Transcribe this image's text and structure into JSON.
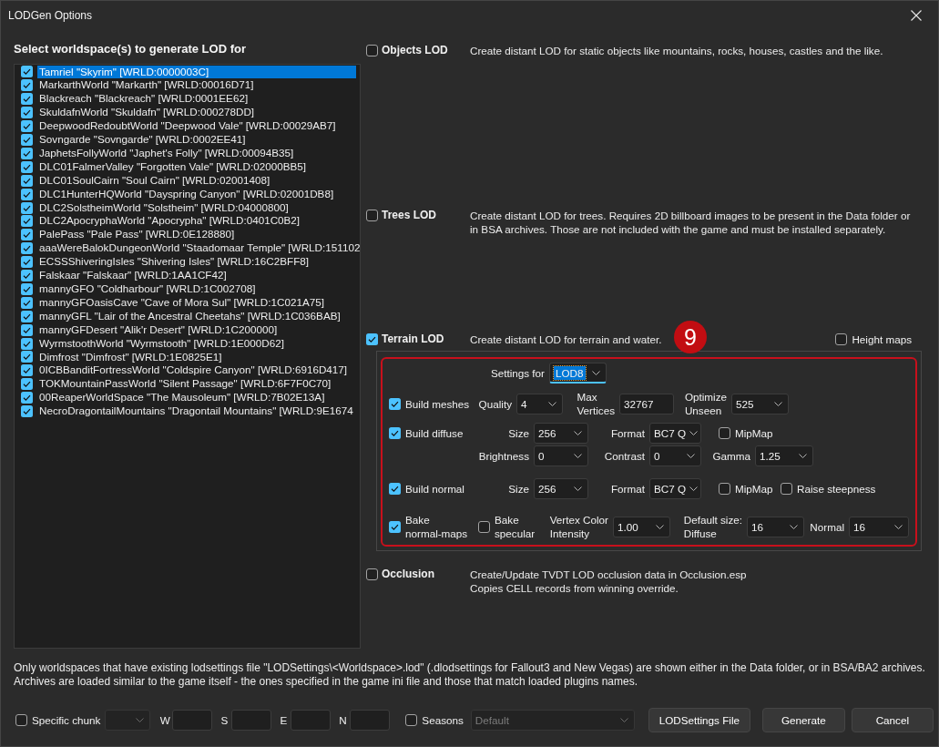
{
  "window": {
    "title": "LODGen Options"
  },
  "worldspaces": {
    "heading": "Select worldspace(s) to generate LOD for",
    "items": [
      {
        "label": "Tamriel \"Skyrim\" [WRLD:0000003C]",
        "checked": true,
        "selected": true
      },
      {
        "label": "MarkarthWorld \"Markarth\" [WRLD:00016D71]",
        "checked": true,
        "selected": false
      },
      {
        "label": "Blackreach \"Blackreach\" [WRLD:0001EE62]",
        "checked": true,
        "selected": false
      },
      {
        "label": "SkuldafnWorld \"Skuldafn\" [WRLD:000278DD]",
        "checked": true,
        "selected": false
      },
      {
        "label": "DeepwoodRedoubtWorld \"Deepwood Vale\" [WRLD:00029AB7]",
        "checked": true,
        "selected": false
      },
      {
        "label": "Sovngarde \"Sovngarde\" [WRLD:0002EE41]",
        "checked": true,
        "selected": false
      },
      {
        "label": "JaphetsFollyWorld \"Japhet's Folly\" [WRLD:00094B35]",
        "checked": true,
        "selected": false
      },
      {
        "label": "DLC01FalmerValley \"Forgotten Vale\" [WRLD:02000BB5]",
        "checked": true,
        "selected": false
      },
      {
        "label": "DLC01SoulCairn \"Soul Cairn\" [WRLD:02001408]",
        "checked": true,
        "selected": false
      },
      {
        "label": "DLC1HunterHQWorld \"Dayspring Canyon\" [WRLD:02001DB8]",
        "checked": true,
        "selected": false
      },
      {
        "label": "DLC2SolstheimWorld \"Solstheim\" [WRLD:04000800]",
        "checked": true,
        "selected": false
      },
      {
        "label": "DLC2ApocryphaWorld \"Apocrypha\" [WRLD:0401C0B2]",
        "checked": true,
        "selected": false
      },
      {
        "label": "PalePass \"Pale Pass\" [WRLD:0E128880]",
        "checked": true,
        "selected": false
      },
      {
        "label": "aaaWereBalokDungeonWorld \"Staadomaar Temple\" [WRLD:151102",
        "checked": true,
        "selected": false
      },
      {
        "label": "ECSSShiveringIsles \"Shivering Isles\" [WRLD:16C2BFF8]",
        "checked": true,
        "selected": false
      },
      {
        "label": "Falskaar \"Falskaar\" [WRLD:1AA1CF42]",
        "checked": true,
        "selected": false
      },
      {
        "label": "mannyGFO \"Coldharbour\" [WRLD:1C002708]",
        "checked": true,
        "selected": false
      },
      {
        "label": "mannyGFOasisCave \"Cave of Mora Sul\" [WRLD:1C021A75]",
        "checked": true,
        "selected": false
      },
      {
        "label": "mannyGFL \"Lair of the Ancestral Cheetahs\" [WRLD:1C036BAB]",
        "checked": true,
        "selected": false
      },
      {
        "label": "mannyGFDesert \"Alik'r Desert\" [WRLD:1C200000]",
        "checked": true,
        "selected": false
      },
      {
        "label": "WyrmstoothWorld \"Wyrmstooth\" [WRLD:1E000D62]",
        "checked": true,
        "selected": false
      },
      {
        "label": "Dimfrost \"Dimfrost\" [WRLD:1E0825E1]",
        "checked": true,
        "selected": false
      },
      {
        "label": "0ICBBanditFortressWorld \"Coldspire Canyon\" [WRLD:6916D417]",
        "checked": true,
        "selected": false
      },
      {
        "label": "TOKMountainPassWorld \"Silent Passage\" [WRLD:6F7F0C70]",
        "checked": true,
        "selected": false
      },
      {
        "label": "00ReaperWorldSpace \"The Mausoleum\" [WRLD:7B02E13A]",
        "checked": true,
        "selected": false
      },
      {
        "label": "NecroDragontailMountains \"Dragontail Mountains\" [WRLD:9E1674",
        "checked": true,
        "selected": false
      }
    ]
  },
  "sections": [
    {
      "label": "Objects LOD",
      "checked": false,
      "description": "Create distant LOD for static objects like mountains, rocks, houses, castles and the like."
    },
    {
      "label": "Trees LOD",
      "checked": false,
      "description": "Create distant LOD for trees. Requires 2D billboard images to be present in the Data folder or\nin BSA archives. Those are not included with the game and must be installed separately."
    },
    {
      "label": "Terrain LOD",
      "checked": true,
      "description": "Create distant LOD for terrain and water.",
      "annotation": {
        "number": "9"
      },
      "option": {
        "label": "Height maps",
        "checked": false
      },
      "settings": {
        "rows": [
          {
            "items": [
              {
                "kind": "label",
                "text": "Settings for"
              },
              {
                "kind": "dropdown",
                "value": "LOD8",
                "focused": true
              }
            ]
          },
          {
            "toggle": {
              "label": "Build meshes",
              "checked": true
            },
            "items": [
              {
                "kind": "label",
                "text": "Quality"
              },
              {
                "kind": "dropdown",
                "value": "4",
                "focused": false
              },
              {
                "kind": "label",
                "text": "Max\nVertices"
              },
              {
                "kind": "input",
                "value": "32767"
              },
              {
                "kind": "label",
                "text": "Optimize\nUnseen"
              },
              {
                "kind": "dropdown",
                "value": "525",
                "focused": false
              }
            ]
          },
          {
            "toggle": {
              "label": "Build diffuse",
              "checked": true
            },
            "items": [
              {
                "kind": "label",
                "text": "Size"
              },
              {
                "kind": "dropdown",
                "value": "256",
                "focused": false
              },
              {
                "kind": "label",
                "text": "Format"
              },
              {
                "kind": "dropdown",
                "value": "BC7 Q",
                "focused": false
              },
              {
                "kind": "checkbox",
                "label": "MipMap",
                "checked": false
              }
            ]
          },
          {
            "items": [
              {
                "kind": "label",
                "text": "Brightness"
              },
              {
                "kind": "dropdown",
                "value": "0",
                "focused": false
              },
              {
                "kind": "label",
                "text": "Contrast"
              },
              {
                "kind": "dropdown",
                "value": "0",
                "focused": false
              },
              {
                "kind": "label",
                "text": "Gamma"
              },
              {
                "kind": "dropdown",
                "value": "1.25",
                "focused": false
              }
            ]
          },
          {
            "toggle": {
              "label": "Build normal",
              "checked": true
            },
            "items": [
              {
                "kind": "label",
                "text": "Size"
              },
              {
                "kind": "dropdown",
                "value": "256",
                "focused": false
              },
              {
                "kind": "label",
                "text": "Format"
              },
              {
                "kind": "dropdown",
                "value": "BC7 Q",
                "focused": false
              },
              {
                "kind": "checkbox",
                "label": "MipMap",
                "checked": false
              },
              {
                "kind": "checkbox",
                "label": "Raise steepness",
                "checked": false
              }
            ]
          },
          {
            "toggle": {
              "label": "Bake\nnormal-maps",
              "checked": true
            },
            "items": [
              {
                "kind": "checkbox",
                "label": "Bake\nspecular",
                "checked": false
              },
              {
                "kind": "label",
                "text": "Vertex Color\nIntensity"
              },
              {
                "kind": "dropdown",
                "value": "1.00",
                "focused": false
              },
              {
                "kind": "label",
                "text": "Default size:\nDiffuse"
              },
              {
                "kind": "dropdown",
                "value": "16",
                "focused": false
              },
              {
                "kind": "label",
                "text": "Normal"
              },
              {
                "kind": "dropdown",
                "value": "16",
                "focused": false
              }
            ]
          }
        ]
      }
    },
    {
      "label": "Occlusion",
      "checked": false,
      "description": "Create/Update TVDT LOD occlusion data in Occlusion.esp\nCopies CELL records from winning override."
    }
  ],
  "note": "Only worldspaces that have existing lodsettings file \"LODSettings\\<Worldspace>.lod\" (.dlodsettings for Fallout3 and New Vegas) are shown either in the Data folder, or in BSA/BA2 archives.\nArchives are loaded similar to the game itself - the ones specified in the game ini file and those that match loaded plugins names.",
  "footer": {
    "chunk": {
      "label": "Specific chunk",
      "checked": false
    },
    "chunk_select": {
      "disabled": true
    },
    "coordinates": [
      {
        "label": "W"
      },
      {
        "label": "S"
      },
      {
        "label": "E"
      },
      {
        "label": "N"
      }
    ],
    "seasons": {
      "label": "Seasons",
      "checked": false
    },
    "season_select": {
      "value": "Default",
      "disabled": true
    },
    "buttons": [
      {
        "label": "LODSettings File"
      },
      {
        "label": "Generate"
      },
      {
        "label": "Cancel"
      }
    ]
  }
}
